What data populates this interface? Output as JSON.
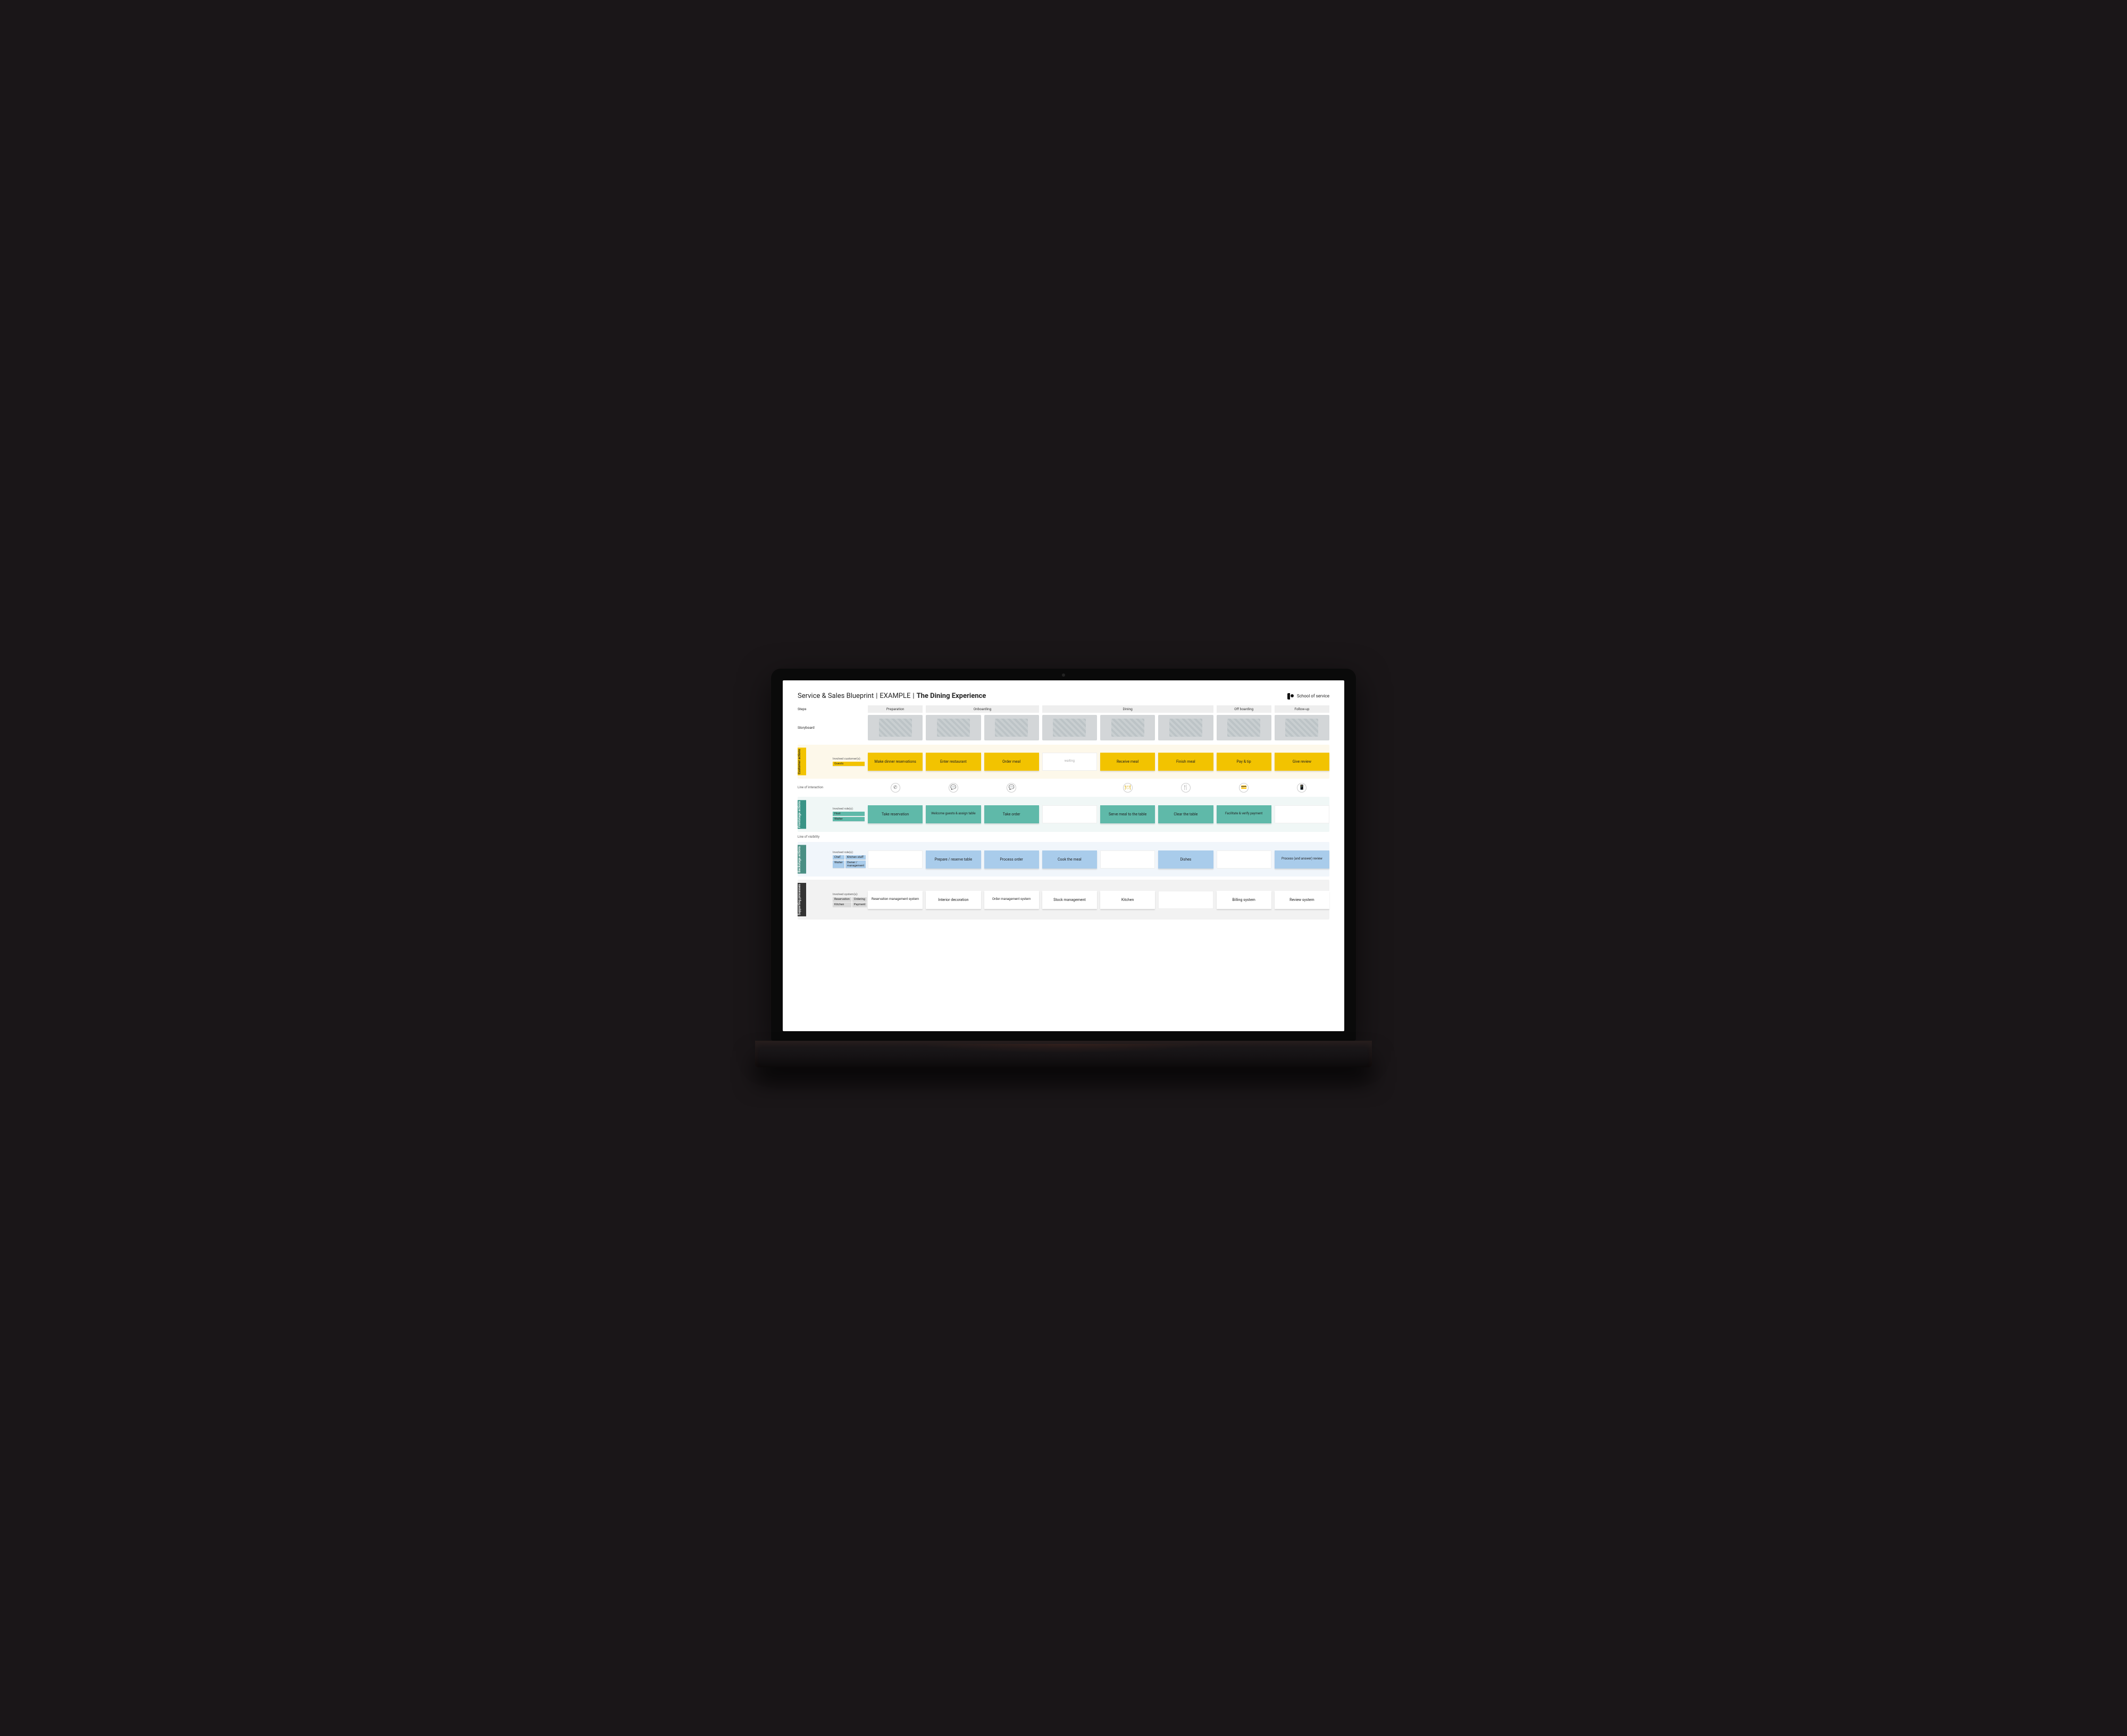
{
  "header": {
    "title_prefix": "Service & Sales Blueprint",
    "title_mid": "EXAMPLE",
    "title_bold": "The Dining Experience",
    "brand": "School of service"
  },
  "row_labels": {
    "steps": "Steps",
    "storyboard": "Storyboard",
    "line_interaction": "Line of interaction",
    "line_visibility": "Line of visibility"
  },
  "phases": [
    "Preparation",
    "Onboarding",
    "Dining",
    "Off boarding",
    "Follow-up"
  ],
  "lanes": {
    "customer": {
      "tab": "Customer actions",
      "involved_label": "Involved customer(s):",
      "involved": [
        "Guests"
      ],
      "items": [
        {
          "text": "Make dinner reservations"
        },
        {
          "text": "Enter restaurant"
        },
        {
          "text": "Order meal"
        },
        {
          "text": "waiting",
          "muted": true
        },
        {
          "text": "Receive meal"
        },
        {
          "text": "Finish meal"
        },
        {
          "text": "Pay & tip"
        },
        {
          "text": "Give review"
        }
      ]
    },
    "frontstage": {
      "tab": "Frontstage actions",
      "involved_label": "Involved role(s):",
      "involved": [
        "Host",
        "Waiter"
      ],
      "items": [
        {
          "text": "Take reservation"
        },
        {
          "text": "Welcome guests & assign table"
        },
        {
          "text": "Take order"
        },
        {
          "text": ""
        },
        {
          "text": "Serve meal to the table"
        },
        {
          "text": "Clear the table"
        },
        {
          "text": "Facilitate & verify payment"
        },
        {
          "text": ""
        }
      ]
    },
    "backstage": {
      "tab": "Backstage actions",
      "involved_label": "Involved role(s):",
      "involved": [
        "Chef",
        "Kitchen staff",
        "Waiter",
        "Owner / management"
      ],
      "items": [
        {
          "text": ""
        },
        {
          "text": "Prepare / reserve table"
        },
        {
          "text": "Process order"
        },
        {
          "text": "Cook the meal"
        },
        {
          "text": ""
        },
        {
          "text": "Dishes"
        },
        {
          "text": ""
        },
        {
          "text": "Process (and answer) review"
        }
      ]
    },
    "supporting": {
      "tab": "Supporting processes",
      "involved_label": "Involved system(s):",
      "involved": [
        "Reservation",
        "Ordering",
        "Kitchen",
        "Payment"
      ],
      "items": [
        {
          "text": "Reservation management system"
        },
        {
          "text": "Interior decoration"
        },
        {
          "text": "Order management system"
        },
        {
          "text": "Stock management"
        },
        {
          "text": "Kitchen"
        },
        {
          "text": ""
        },
        {
          "text": "Billing system"
        },
        {
          "text": "Review system"
        }
      ]
    }
  },
  "interaction_icons": [
    "phone",
    "chat",
    "chat",
    "",
    "plate",
    "cutlery",
    "card",
    "mobile"
  ]
}
